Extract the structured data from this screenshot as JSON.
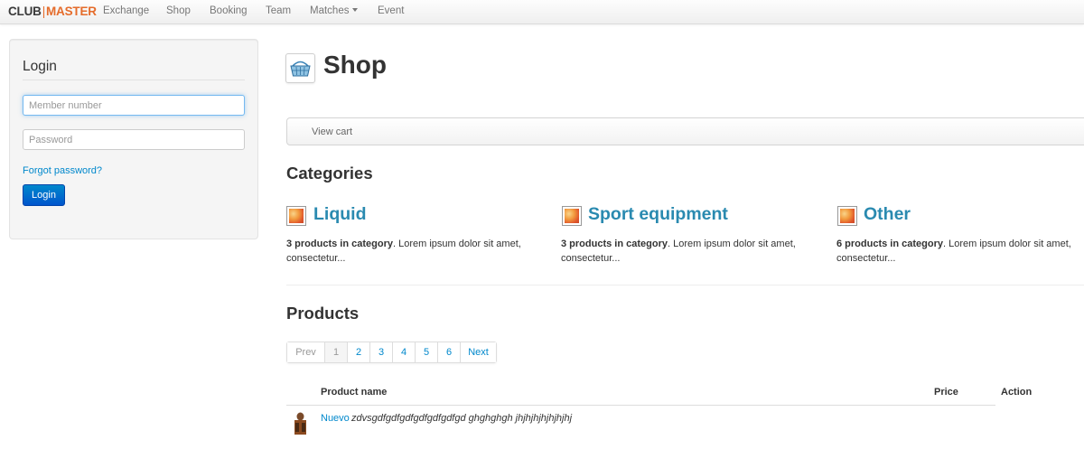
{
  "navbar": {
    "brand_part1": "CLUB",
    "brand_separator": "|",
    "brand_part2": "MASTER",
    "brand_color": "#e56c2b",
    "items": [
      {
        "label": "Exchange"
      },
      {
        "label": "Shop"
      },
      {
        "label": "Booking"
      },
      {
        "label": "Team"
      },
      {
        "label": "Matches",
        "dropdown": true
      },
      {
        "label": "Event"
      }
    ]
  },
  "login": {
    "title": "Login",
    "member_placeholder": "Member number",
    "member_value": "",
    "password_placeholder": "Password",
    "password_value": "",
    "forgot_label": "Forgot password?",
    "button_label": "Login"
  },
  "shop": {
    "icon": "basket-icon",
    "title": "Shop",
    "view_cart_label": "View cart"
  },
  "categories": {
    "title": "Categories",
    "items": [
      {
        "name": "Liquid",
        "count_text": "3 products in category",
        "desc": ". Lorem ipsum dolor sit amet, consectetur..."
      },
      {
        "name": "Sport equipment",
        "count_text": "3 products in category",
        "desc": ". Lorem ipsum dolor sit amet, consectetur..."
      },
      {
        "name": "Other",
        "count_text": "6 products in category",
        "desc": ". Lorem ipsum dolor sit amet, consectetur..."
      }
    ]
  },
  "products": {
    "title": "Products",
    "pagination": {
      "prev": "Prev",
      "pages": [
        "1",
        "2",
        "3",
        "4",
        "5",
        "6"
      ],
      "next": "Next",
      "active": "1"
    },
    "columns": {
      "name": "Product name",
      "price": "Price",
      "action": "Action"
    },
    "rows": [
      {
        "name": "Nuevo",
        "description": "zdvsgdfgdfgdfgdfgdfgdfgd ghghghgh jhjhjhjhjhjhjhj",
        "price": ""
      }
    ]
  },
  "colors": {
    "link": "#0088cc",
    "category_link": "#2a8ab0",
    "primary_button": "#0088cc"
  }
}
